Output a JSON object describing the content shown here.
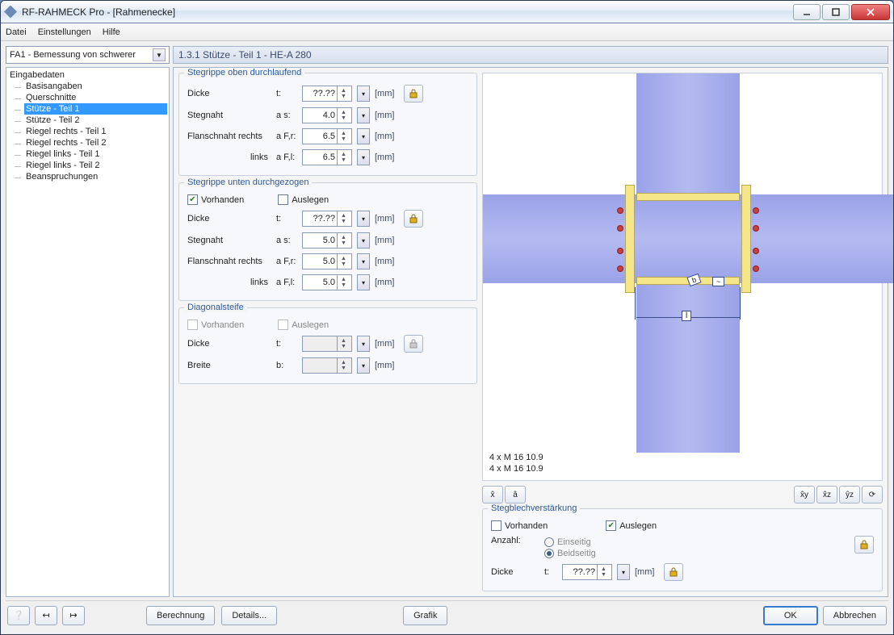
{
  "window": {
    "title": "RF-RAHMECK Pro - [Rahmenecke]"
  },
  "menu": {
    "file": "Datei",
    "settings": "Einstellungen",
    "help": "Hilfe"
  },
  "load_case_combo": "FA1 - Bemessung von schwerer",
  "content_title": "1.3.1 Stütze - Teil 1 - HE-A 280",
  "tree": {
    "root": "Eingabedaten",
    "items": [
      "Basisangaben",
      "Querschnitte",
      "Stütze - Teil 1",
      "Stütze - Teil 2",
      "Riegel rechts - Teil 1",
      "Riegel rechts - Teil 2",
      "Riegel links - Teil 1",
      "Riegel links - Teil 2",
      "Beanspruchungen"
    ],
    "selected_index": 2
  },
  "groups": {
    "top": {
      "title": "Stegrippe oben durchlaufend",
      "thickness": {
        "label": "Dicke",
        "symbol": "t:",
        "value": "??.??",
        "unit": "[mm]"
      },
      "web_weld": {
        "label": "Stegnaht",
        "symbol": "a s:",
        "value": "4.0",
        "unit": "[mm]"
      },
      "flange_weld_r": {
        "label": "Flanschnaht rechts",
        "symbol": "a F,r:",
        "value": "6.5",
        "unit": "[mm]"
      },
      "flange_weld_l": {
        "label": "links",
        "symbol": "a F,l:",
        "value": "6.5",
        "unit": "[mm]"
      }
    },
    "bottom": {
      "title": "Stegrippe unten durchgezogen",
      "present": {
        "label": "Vorhanden",
        "checked": true
      },
      "auto": {
        "label": "Auslegen",
        "checked": false
      },
      "thickness": {
        "label": "Dicke",
        "symbol": "t:",
        "value": "??.??",
        "unit": "[mm]"
      },
      "web_weld": {
        "label": "Stegnaht",
        "symbol": "a s:",
        "value": "5.0",
        "unit": "[mm]"
      },
      "flange_weld_r": {
        "label": "Flanschnaht rechts",
        "symbol": "a F,r:",
        "value": "5.0",
        "unit": "[mm]"
      },
      "flange_weld_l": {
        "label": "links",
        "symbol": "a F,l:",
        "value": "5.0",
        "unit": "[mm]"
      }
    },
    "diag": {
      "title": "Diagonalsteife",
      "present": {
        "label": "Vorhanden",
        "checked": false
      },
      "auto": {
        "label": "Auslegen",
        "checked": false
      },
      "thickness": {
        "label": "Dicke",
        "symbol": "t:",
        "value": "",
        "unit": "[mm]"
      },
      "width": {
        "label": "Breite",
        "symbol": "b:",
        "value": "",
        "unit": "[mm]"
      }
    },
    "webplate": {
      "title": "Stegblechverstärkung",
      "present": {
        "label": "Vorhanden",
        "checked": false
      },
      "auto": {
        "label": "Auslegen",
        "checked": true
      },
      "count": {
        "label": "Anzahl:",
        "opt1": "Einseitig",
        "opt2": "Beidseitig",
        "selected": "Beidseitig"
      },
      "thickness": {
        "label": "Dicke",
        "symbol": "t:",
        "value": "??.??",
        "unit": "[mm]"
      }
    }
  },
  "viewer": {
    "annot1": "4 x M 16 10.9",
    "annot2": "4 x M 16 10.9",
    "dim_label": "l"
  },
  "footer": {
    "calc": "Berechnung",
    "details": "Details...",
    "graphic": "Grafik",
    "ok": "OK",
    "cancel": "Abbrechen"
  }
}
